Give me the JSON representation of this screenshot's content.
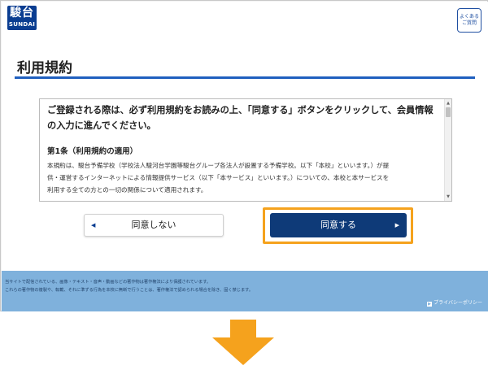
{
  "header": {
    "logo_kanji": "駿台",
    "logo_latin": "SUNDAI",
    "faq_line1": "よくある",
    "faq_line2": "ご質問"
  },
  "page_title": "利用規約",
  "terms": {
    "lead_line1": "ご登録される際は、必ず利用規約をお読みの上、「同意する」ボタンをクリックして、会員情報",
    "lead_line2": "の入力に進んでください。",
    "heading": "第1条（利用規約の適用）",
    "body_line1": "本規約は、駿台予備学校（学校法人駿河台学園等駿台グループ各法人が設置する予備学校。以下「本校」といいます。）が提",
    "body_line2": "供・運営するインターネットによる情報提供サービス（以下「本サービス」といいます。）についての、本校と本サービスを",
    "body_line3": "利用する全ての方との一切の関係について適用されます。"
  },
  "buttons": {
    "disagree_label": "同意しない",
    "agree_label": "同意する"
  },
  "footer": {
    "notice_line1": "当サイトで配信されている、画像・テキスト・音声・動画などの著作物は著作権法により保護されています。",
    "notice_line2": "これらの著作物の複製や、転載、それに準ずる行為を本校に無断で行うことは、著作権法で認められる場合を除き、固く禁じます。",
    "privacy_label": "プライバシーポリシー"
  },
  "colors": {
    "brand_blue": "#0a3d91",
    "title_rule": "#1f5fbf",
    "agree_button": "#0e3a78",
    "highlight": "#f5a21d",
    "footer_bg": "#7fb1dc",
    "arrow": "#f5a21d"
  },
  "icons": {
    "disagree_arrow": "triangle-left-icon",
    "agree_arrow": "triangle-right-icon",
    "down_arrow": "arrow-down-icon"
  }
}
